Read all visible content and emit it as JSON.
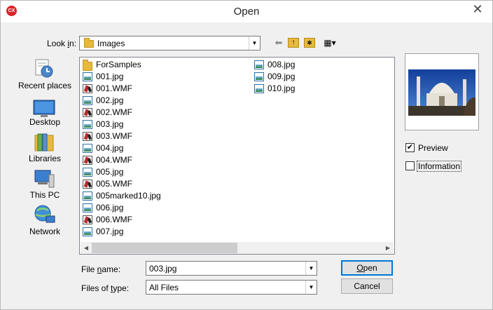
{
  "window": {
    "title": "Open",
    "app_icon_text": "CX",
    "close_glyph": "✕"
  },
  "lookin": {
    "label_pre": "Look ",
    "label_accel": "i",
    "label_post": "n:",
    "value": "Images"
  },
  "toolbar": {
    "back_glyph": "⬅",
    "up_glyph": "↑",
    "newfolder_glyph": "✱",
    "view_glyph": "▦▾"
  },
  "places": [
    {
      "label": "Recent places",
      "icon": "recent-places-icon"
    },
    {
      "label": "Desktop",
      "icon": "desktop-icon"
    },
    {
      "label": "Libraries",
      "icon": "libraries-icon"
    },
    {
      "label": "This PC",
      "icon": "this-pc-icon"
    },
    {
      "label": "Network",
      "icon": "network-icon"
    }
  ],
  "files": [
    {
      "name": "ForSamples",
      "type": "folder"
    },
    {
      "name": "001.jpg",
      "type": "jpg"
    },
    {
      "name": "001.WMF",
      "type": "wmf"
    },
    {
      "name": "002.jpg",
      "type": "jpg"
    },
    {
      "name": "002.WMF",
      "type": "wmf"
    },
    {
      "name": "003.jpg",
      "type": "jpg"
    },
    {
      "name": "003.WMF",
      "type": "wmf"
    },
    {
      "name": "004.jpg",
      "type": "jpg"
    },
    {
      "name": "004.WMF",
      "type": "wmf"
    },
    {
      "name": "005.jpg",
      "type": "jpg"
    },
    {
      "name": "005.WMF",
      "type": "wmf"
    },
    {
      "name": "005marked10.jpg",
      "type": "jpg"
    },
    {
      "name": "006.jpg",
      "type": "jpg"
    },
    {
      "name": "006.WMF",
      "type": "wmf"
    },
    {
      "name": "007.jpg",
      "type": "jpg"
    },
    {
      "name": "008.jpg",
      "type": "jpg"
    },
    {
      "name": "009.jpg",
      "type": "jpg"
    },
    {
      "name": "010.jpg",
      "type": "jpg"
    }
  ],
  "preview_options": {
    "preview_label": "Preview",
    "preview_checked": true,
    "check_glyph": "✔",
    "information_label": "Information",
    "information_checked": false
  },
  "filename": {
    "label_pre": "File ",
    "label_accel": "n",
    "label_post": "ame:",
    "value": "003.jpg"
  },
  "filetype": {
    "label_pre": "Files of ",
    "label_accel": "t",
    "label_post": "ype:",
    "value": "All Files"
  },
  "buttons": {
    "open_accel": "O",
    "open_rest": "pen",
    "cancel": "Cancel"
  },
  "scroll": {
    "left_glyph": "◀",
    "right_glyph": "▶",
    "combo_glyph": "▼"
  }
}
